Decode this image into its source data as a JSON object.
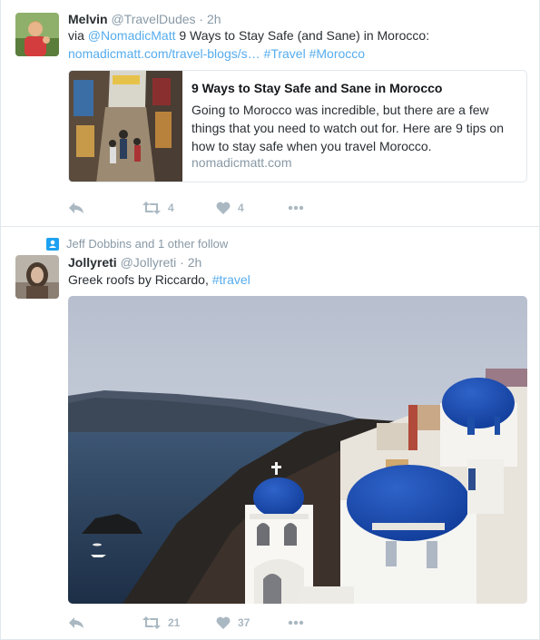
{
  "tweets": [
    {
      "name": "Melvin",
      "handle": "@TravelDudes",
      "separator": "·",
      "time": "2h",
      "text_prefix": "via ",
      "mention": "@NomadicMatt",
      "text_main": " 9 Ways to Stay Safe (and Sane) in Morocco:",
      "url": "nomadicmatt.com/travel-blogs/s…",
      "hashtag1": "#Travel",
      "hashtag2": "#Morocco",
      "card": {
        "title": "9 Ways to Stay Safe and Sane in Morocco",
        "description": "Going to Morocco was incredible, but there are a few things that you need to watch out for. Here are 9 tips on how to stay safe when you travel Morocco.",
        "domain": "nomadicmatt.com"
      },
      "retweets": "4",
      "likes": "4"
    },
    {
      "social_context": "Jeff Dobbins and 1 other follow",
      "name": "Jollyreti",
      "handle": "@Jollyreti",
      "separator": "·",
      "time": "2h",
      "text_main": "Greek roofs by Riccardo, ",
      "hashtag1": "#travel",
      "retweets": "21",
      "likes": "37"
    }
  ],
  "colors": {
    "link": "#55acee",
    "muted": "#8899a6",
    "action": "#aab8c2",
    "border": "#e1e8ed"
  }
}
